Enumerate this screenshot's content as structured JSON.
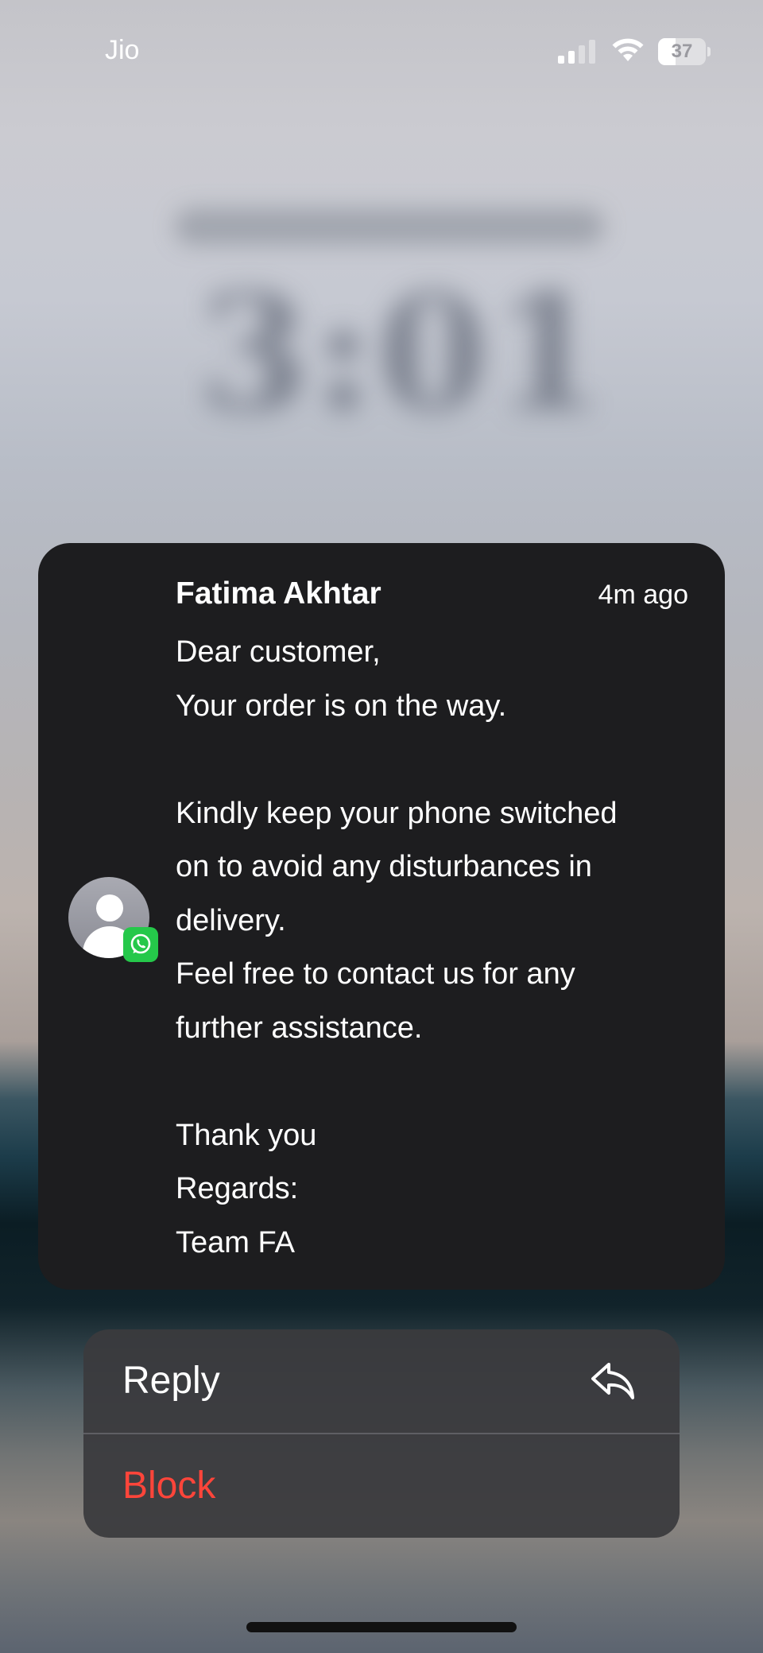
{
  "status_bar": {
    "carrier": "Jio",
    "battery_level": "37",
    "battery_fraction": 0.37,
    "icons": [
      "signal-icon",
      "wifi-icon",
      "battery-icon"
    ]
  },
  "notification": {
    "sender": "Fatima Akhtar",
    "time_ago": "4m ago",
    "app_icon": "whatsapp-icon",
    "avatar_icon": "person-icon",
    "message_lines": [
      "Dear customer,",
      "Your order is on the way.",
      "",
      "Kindly keep your phone switched",
      "on to avoid any disturbances in",
      "delivery.",
      "Feel free to contact us for any",
      "further assistance.",
      "",
      "Thank you",
      "Regards:",
      "Team FA"
    ]
  },
  "actions": {
    "reply_label": "Reply",
    "reply_icon": "reply-arrow-icon",
    "block_label": "Block"
  },
  "colors": {
    "card_background": "#1d1d1f",
    "destructive": "#ff453a",
    "whatsapp_green": "#25c84a"
  }
}
